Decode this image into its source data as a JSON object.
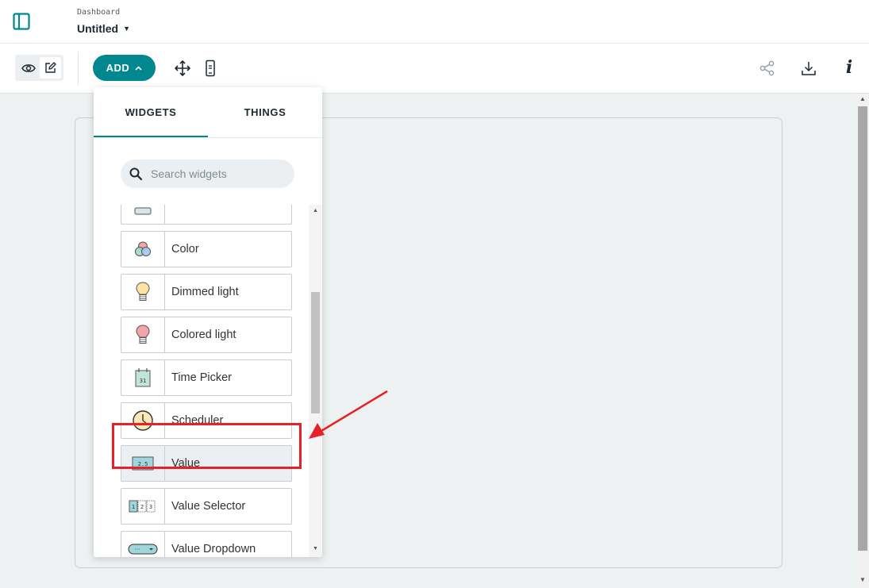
{
  "header": {
    "breadcrumb": "Dashboard",
    "title": "Untitled"
  },
  "toolbar": {
    "add_label": "ADD"
  },
  "panel": {
    "tabs": [
      {
        "label": "WIDGETS",
        "active": true
      },
      {
        "label": "THINGS",
        "active": false
      }
    ],
    "search_placeholder": "Search widgets",
    "items": [
      {
        "label": "",
        "icon": "widget-icon"
      },
      {
        "label": "Color",
        "icon": "color-icon"
      },
      {
        "label": "Dimmed light",
        "icon": "dimmed-light-icon"
      },
      {
        "label": "Colored light",
        "icon": "colored-light-icon"
      },
      {
        "label": "Time Picker",
        "icon": "calendar-icon",
        "icon_text": "31"
      },
      {
        "label": "Scheduler",
        "icon": "clock-icon"
      },
      {
        "label": "Value",
        "icon": "value-display-icon",
        "icon_text": "2.5",
        "selected": true
      },
      {
        "label": "Value Selector",
        "icon": "value-selector-icon",
        "icon_text": [
          "1",
          "2",
          "3"
        ]
      },
      {
        "label": "Value Dropdown",
        "icon": "dropdown-icon",
        "icon_text": "···"
      }
    ]
  },
  "colors": {
    "accent": "#00878f",
    "annotation": "#e82027",
    "canvas_bg": "#edf1f1"
  }
}
